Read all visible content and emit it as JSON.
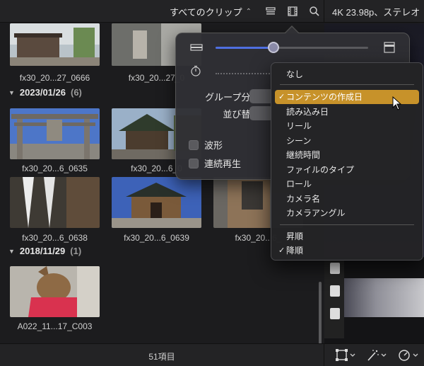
{
  "topbar": {
    "clip_filter_label": "すべてのクリップ",
    "clip_filter_chevron": "⌃⌄",
    "icons": [
      "clip-appearance-icon",
      "filmstrip-icon",
      "search-icon"
    ],
    "viewer_info": "4K 23.98p、ステレオ"
  },
  "browser": {
    "clips_top": [
      {
        "label": "fx30_20...27_0666"
      },
      {
        "label": "fx30_20...27_0"
      }
    ],
    "groups": [
      {
        "date": "2023/01/26",
        "count": "(6)",
        "clips": [
          {
            "label": "fx30_20...6_0635"
          },
          {
            "label": "fx30_20...6_0"
          },
          {
            "label": "fx30_20...6_0638"
          },
          {
            "label": "fx30_20...6_0639"
          },
          {
            "label": "fx30_20...6_"
          }
        ]
      },
      {
        "date": "2018/11/29",
        "count": "(1)",
        "clips": [
          {
            "label": "A022_11...17_C003"
          }
        ]
      }
    ]
  },
  "popover": {
    "group_label": "グループ分け:",
    "sort_label": "並び替え:",
    "waveform_label": "波形",
    "continuous_label": "連続再生"
  },
  "menu": {
    "items": [
      {
        "label": "なし",
        "checked": false,
        "selected": false
      },
      {
        "label": "コンテンツの作成日",
        "checked": true,
        "selected": true
      },
      {
        "label": "読み込み日",
        "checked": false,
        "selected": false
      },
      {
        "label": "リール",
        "checked": false,
        "selected": false
      },
      {
        "label": "シーン",
        "checked": false,
        "selected": false
      },
      {
        "label": "継続時間",
        "checked": false,
        "selected": false
      },
      {
        "label": "ファイルのタイプ",
        "checked": false,
        "selected": false
      },
      {
        "label": "ロール",
        "checked": false,
        "selected": false
      },
      {
        "label": "カメラ名",
        "checked": false,
        "selected": false
      },
      {
        "label": "カメラアングル",
        "checked": false,
        "selected": false
      }
    ],
    "order_items": [
      {
        "label": "昇順",
        "checked": false
      },
      {
        "label": "降順",
        "checked": true
      }
    ],
    "check_glyph": "✓"
  },
  "bottombar": {
    "item_count": "51項目",
    "icons": [
      "transform-icon",
      "magic-wand-icon",
      "speed-icon"
    ]
  },
  "colors": {
    "accent": "#c7922a",
    "slider_blue": "#4f6fe0"
  }
}
